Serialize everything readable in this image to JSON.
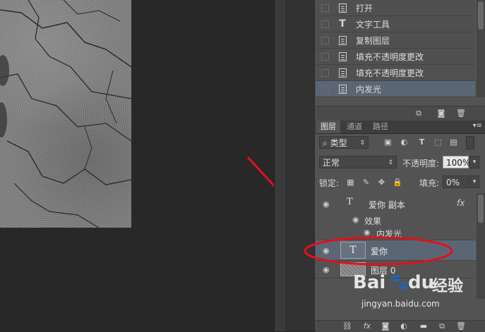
{
  "history": {
    "items": [
      {
        "icon": "document-icon",
        "label": "打开"
      },
      {
        "icon": "type-tool-icon",
        "label": "文字工具"
      },
      {
        "icon": "document-icon",
        "label": "复制图层"
      },
      {
        "icon": "document-icon",
        "label": "填充不透明度更改"
      },
      {
        "icon": "document-icon",
        "label": "填充不透明度更改"
      },
      {
        "icon": "document-icon",
        "label": "内发光",
        "selected": true
      }
    ]
  },
  "layers_panel": {
    "tabs": [
      "图层",
      "通道",
      "路径"
    ],
    "active_tab": "图层",
    "filter_kind": "类型",
    "blend_mode": "正常",
    "opacity_label": "不透明度:",
    "opacity_value": "100%",
    "lock_label": "锁定:",
    "fill_label": "填充:",
    "fill_value": "0%",
    "layers": [
      {
        "type": "text",
        "name": "爱你 副本",
        "fx": "fx",
        "effects_label": "效果",
        "effect": "内发光"
      },
      {
        "type": "text",
        "name": "爱你",
        "selected": true
      },
      {
        "type": "image",
        "name": "图层 0"
      }
    ]
  },
  "watermark": {
    "brand": "Bai",
    "brand2": "du",
    "product": "经验",
    "url": "jingyan.baidu.com"
  },
  "annotation_color": "#e3101b",
  "selection_color": "#5b6675"
}
